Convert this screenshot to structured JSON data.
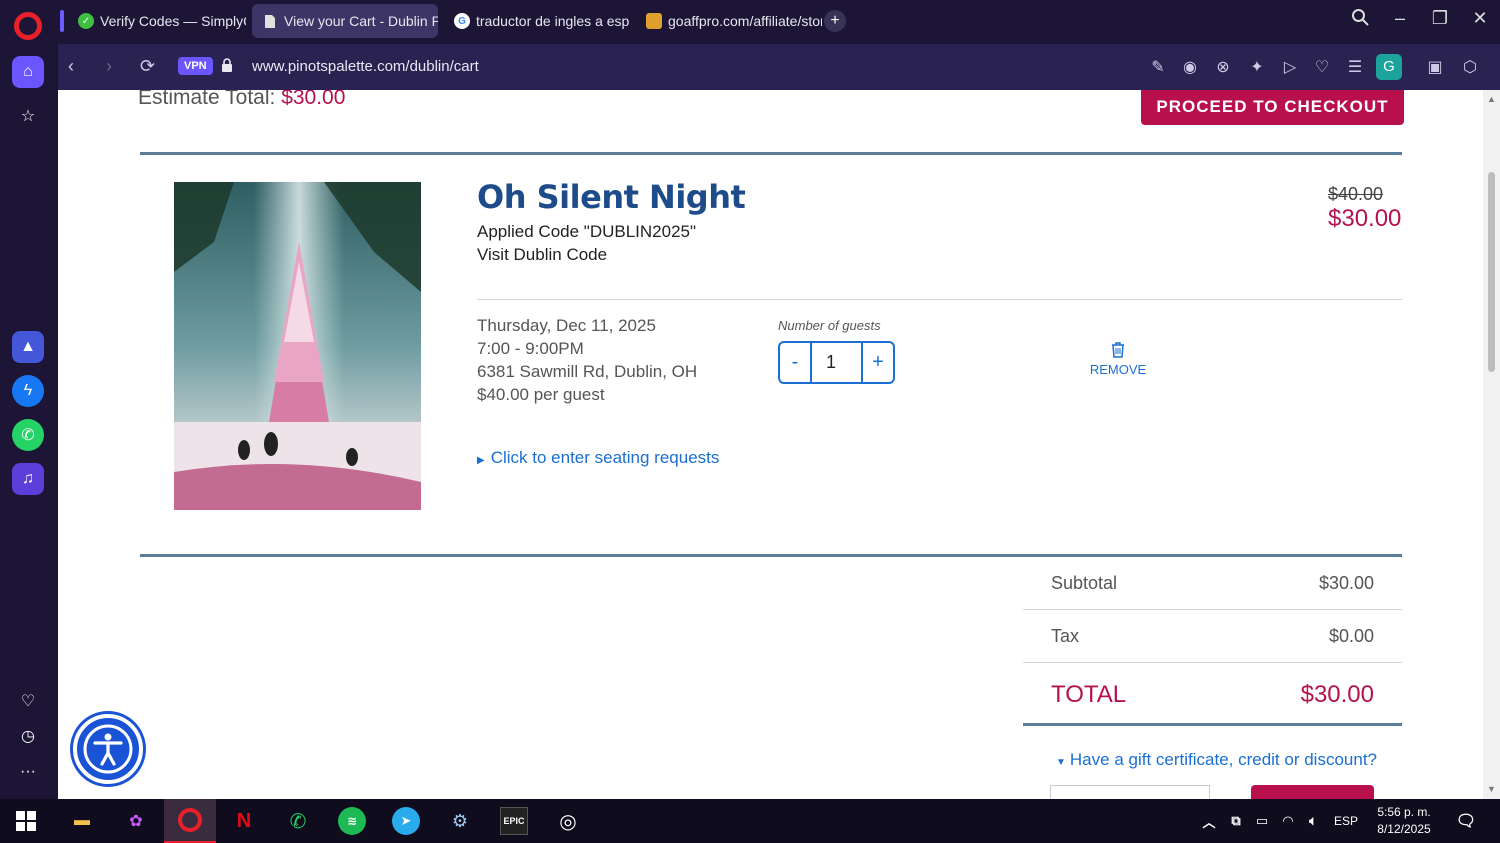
{
  "browser": {
    "tabs": [
      {
        "label": "Verify Codes — SimplyCodes",
        "icon": "simplycodes-icon",
        "color": "#3fbf3f"
      },
      {
        "label": "View your Cart - Dublin Pinot's Palette",
        "icon": "page-icon",
        "color": "#d9d9d9"
      },
      {
        "label": "traductor de ingles a español",
        "icon": "google-icon",
        "color": "#4285f4"
      },
      {
        "label": "goaffpro.com/affiliate/store",
        "icon": "goaffpro-icon",
        "color": "#e0a030"
      }
    ],
    "vpn_label": "VPN",
    "url": "www.pinotspalette.com/dublin/cart",
    "profile_initial": "G"
  },
  "cart": {
    "estimate_label": "Estimate Total:",
    "estimate_value": "$30.00",
    "checkout_label": "PROCEED TO CHECKOUT",
    "item": {
      "title": "Oh Silent Night",
      "applied_code": "Applied Code \"DUBLIN2025\"",
      "visit_code": "Visit Dublin Code",
      "original_price": "$40.00",
      "price": "$30.00",
      "date": "Thursday, Dec 11, 2025",
      "time": "7:00 - 9:00PM",
      "address": "6381 Sawmill Rd, Dublin, OH",
      "per_guest": "$40.00 per guest",
      "guests_label": "Number of guests",
      "guests": "1",
      "minus": "-",
      "plus": "+",
      "remove_label": "REMOVE",
      "seating_link": "Click to enter seating requests"
    },
    "summary": {
      "subtotal_label": "Subtotal",
      "subtotal": "$30.00",
      "tax_label": "Tax",
      "tax": "$0.00",
      "total_label": "TOTAL",
      "total": "$30.00"
    },
    "gift_link": "Have a gift certificate, credit or discount?"
  },
  "taskbar": {
    "language": "ESP",
    "time": "5:56 p. m.",
    "date": "8/12/2025"
  },
  "colors": {
    "accent": "#b5124f",
    "link": "#1b6fd3",
    "title": "#1e4c8a",
    "browser_bg": "#1c1535"
  }
}
